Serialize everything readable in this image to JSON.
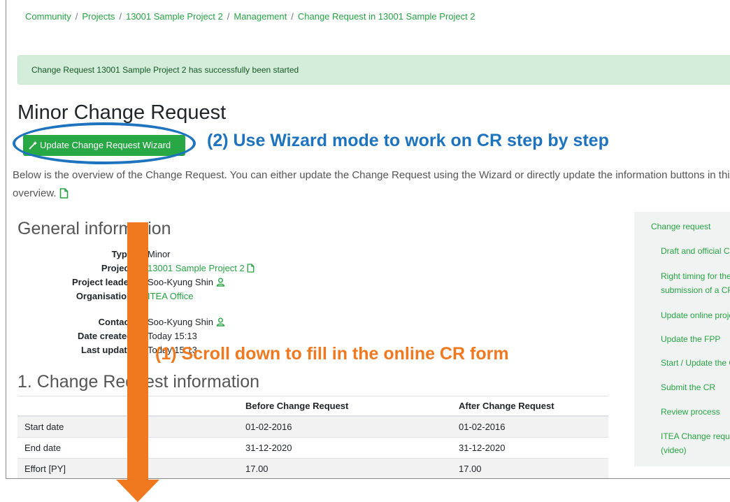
{
  "breadcrumb": [
    "Community",
    "Projects",
    "13001 Sample Project 2",
    "Management",
    "Change Request in 13001 Sample Project 2"
  ],
  "alert_text": "Change Request 13001 Sample Project 2 has successfully been started",
  "page_title": "Minor Change Request",
  "wizard_button_label": "Update Change Request Wizard",
  "annotation_wizard": "(2) Use Wizard mode to work on CR step by step",
  "description": "Below is the overview of the Change Request. You can either update the Change Request using the Wizard or directly update the information buttons in this overview.",
  "general_info": {
    "title": "General information",
    "rows": [
      {
        "label": "Type",
        "value": "Minor"
      },
      {
        "label": "Project",
        "value": "13001 Sample Project 2"
      },
      {
        "label": "Project leader",
        "value": "Soo-Kyung Shin"
      },
      {
        "label": "Organisation",
        "value": "ITEA Office"
      },
      {
        "label": "Contact",
        "value": "Soo-Kyung Shin"
      },
      {
        "label": "Date created",
        "value": "Today 15:13"
      },
      {
        "label": "Last update",
        "value": "Today 15:13"
      }
    ]
  },
  "annotation_scroll": "(1) Scroll down to fill in the online CR form",
  "cr_info": {
    "title": "1. Change Request information",
    "headers": [
      "",
      "Before Change Request",
      "After Change Request"
    ],
    "rows": [
      [
        "Start date",
        "01-02-2016",
        "01-02-2016"
      ],
      [
        "End date",
        "31-12-2020",
        "31-12-2020"
      ],
      [
        "Effort [PY]",
        "17.00",
        "17.00"
      ]
    ]
  },
  "sidebar": {
    "heading": "Change request",
    "items": [
      "Draft and official CR",
      "Right timing for the submission of a CR",
      "Update online project",
      "Update the FPP",
      "Start / Update the CR",
      "Submit the CR",
      "Review process",
      "ITEA Change request (video)"
    ]
  },
  "colors": {
    "accent_green": "#28a745",
    "link_green": "#27a343",
    "annotation_blue": "#1e73be",
    "annotation_orange": "#f07920",
    "alert_bg": "#d4edda"
  }
}
